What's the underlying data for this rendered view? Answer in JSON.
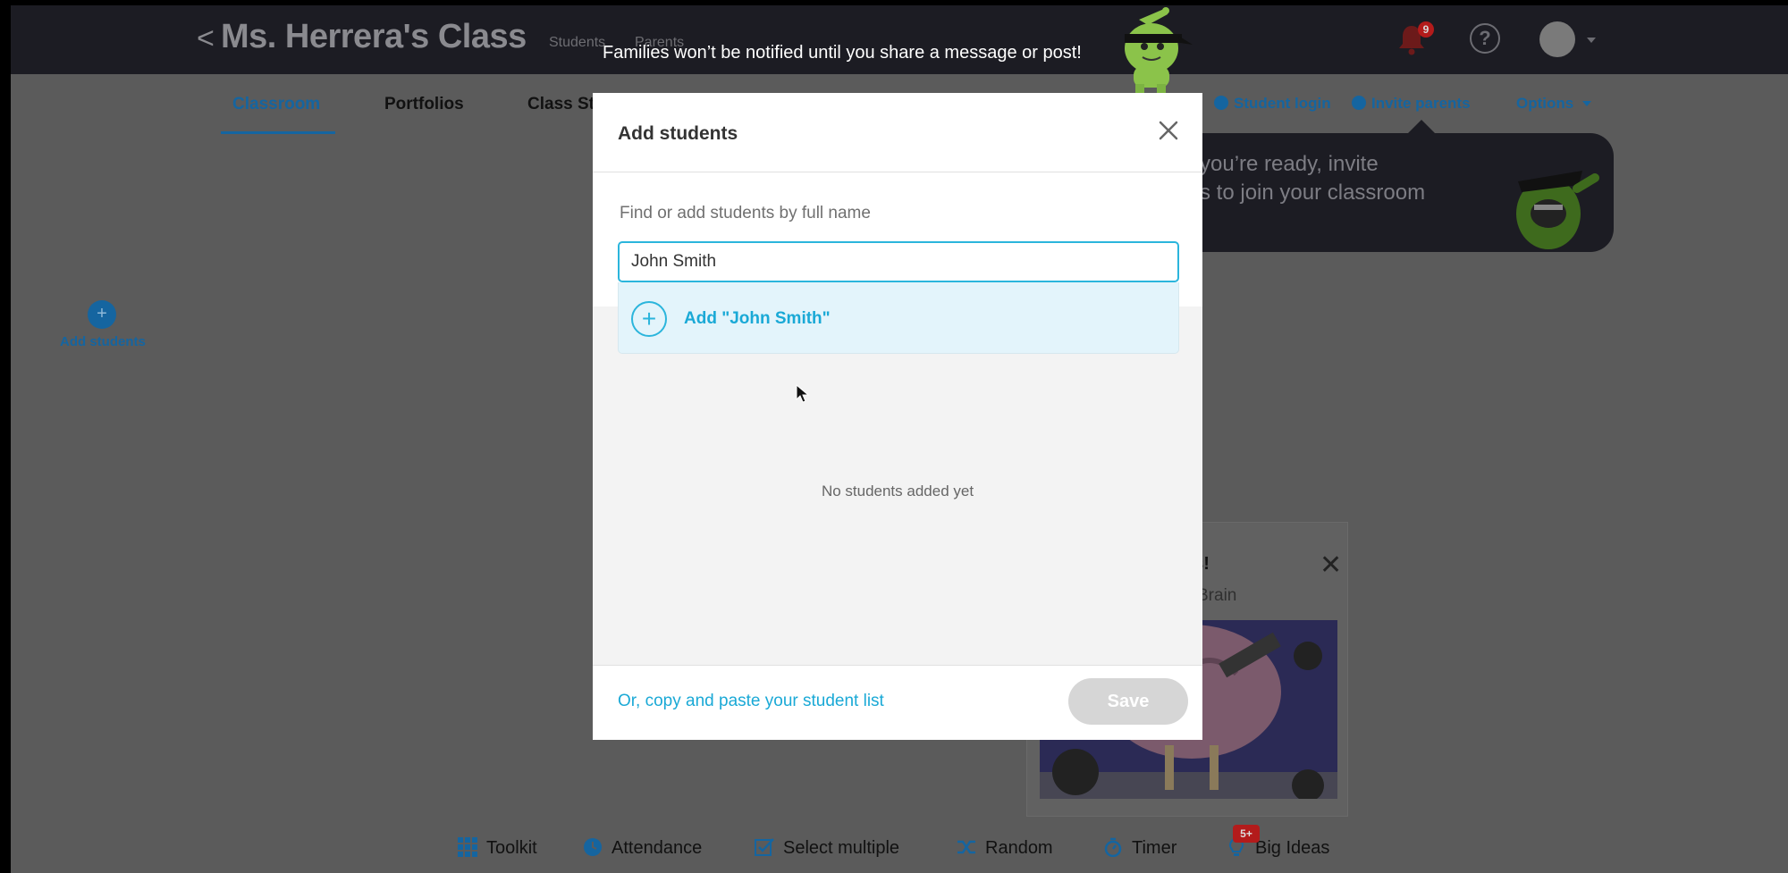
{
  "header": {
    "class_title": "Ms. Herrera's Class",
    "tab_students": "Students",
    "tab_parents": "Parents",
    "notification_count": "9"
  },
  "nav": {
    "classroom": "Classroom",
    "portfolios": "Portfolios",
    "class_story": "Class St",
    "student_login": "Student login",
    "invite_parents": "Invite parents",
    "options": "Options"
  },
  "invite_banner": {
    "text": "n you’re ready, invite\nnts to join your classroom"
  },
  "side": {
    "add_students_label": "Add students"
  },
  "ideas_card": {
    "title": "as!",
    "subtitle": "Brain"
  },
  "toast": {
    "message": "Families won’t be notified until you share a message or post!"
  },
  "modal": {
    "title": "Add students",
    "find_label": "Find or add students by full name",
    "input_value": "John Smith",
    "suggestion": "Add \"John Smith\"",
    "empty_text": "No students added yet",
    "paste_link": "Or, copy and paste your student list",
    "save_label": "Save"
  },
  "toolbar": {
    "toolkit": "Toolkit",
    "attendance": "Attendance",
    "select_multiple": "Select multiple",
    "random": "Random",
    "timer": "Timer",
    "big_ideas": "Big Ideas",
    "big_ideas_badge": "5+"
  },
  "colors": {
    "accent": "#1aa9d6",
    "link_dim": "#1565a0",
    "badge_red": "#b31b1b",
    "overlay_bg": "#5b5b5b"
  }
}
